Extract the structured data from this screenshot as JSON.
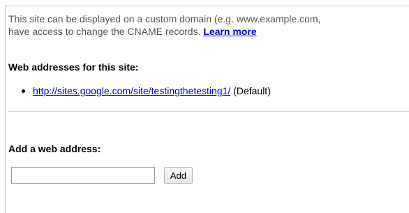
{
  "intro": {
    "line1": "This site can be displayed on a custom domain (e.g. www.example.com,",
    "line2": "have access to change the CNAME records.",
    "learn_more": "Learn more"
  },
  "addresses": {
    "heading": "Web addresses for this site:",
    "items": [
      {
        "url": "http://sites.google.com/site/testingthetesting1/",
        "note": "(Default)"
      }
    ]
  },
  "add_address": {
    "heading": "Add a web address:",
    "input_value": "",
    "button_label": "Add"
  },
  "colors": {
    "link": "#0000cc",
    "intro_text": "#555555",
    "divider": "#d7d7d7"
  }
}
